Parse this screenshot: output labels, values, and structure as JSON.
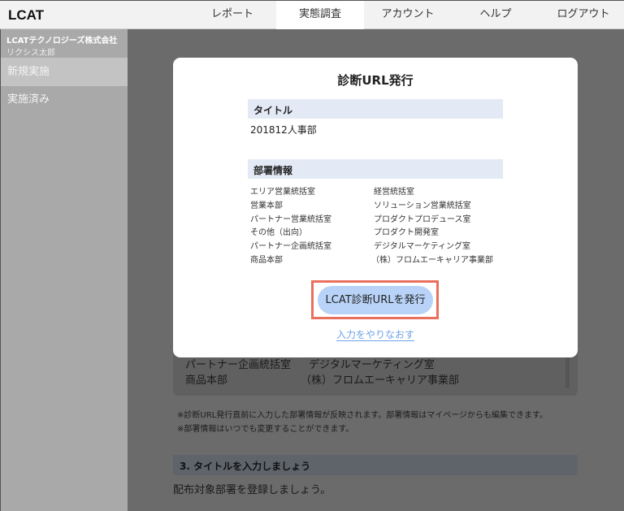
{
  "header": {
    "logo": "LCAT",
    "nav": [
      "レポート",
      "実態調査",
      "アカウント",
      "ヘルプ",
      "ログアウト"
    ],
    "active": "実態調査"
  },
  "sidebar": {
    "company": "LCATテクノロジーズ株式会社",
    "user": "リクシス太郎",
    "items": [
      "新規実施",
      "実施済み"
    ]
  },
  "background": {
    "rows": [
      [
        "パートナー企画統括室",
        "デジタルマーケティング室"
      ],
      [
        "商品本部",
        "（株）フロムエーキャリア事業部"
      ]
    ],
    "notes": [
      "※診断URL発行直前に入力した部署情報が反映されます。部署情報はマイページからも編集できます。",
      "※部署情報はいつでも変更することができます。"
    ],
    "section_title": "3. タイトルを入力しましょう",
    "section_text": "配布対象部署を登録しましょう。"
  },
  "modal": {
    "title": "診断URL発行",
    "title_label": "タイトル",
    "title_value": "201812人事部",
    "dept_label": "部署情報",
    "depts_left": [
      "エリア営業統括室",
      "営業本部",
      "パートナー営業統括室",
      "その他（出向）",
      "パートナー企画統括室",
      "商品本部"
    ],
    "depts_right": [
      "経営統括室",
      "ソリューション営業統括室",
      "プロダクトプロデュース室",
      "プロダクト開発室",
      "デジタルマーケティング室",
      "（株）フロムエーキャリア事業部"
    ],
    "issue_button": "LCAT診断URLを発行",
    "reset_link": "入力をやりなおす"
  },
  "colors": {
    "accent": "#b8d3f7",
    "highlight": "#e8705d",
    "link": "#6fa3e8"
  }
}
